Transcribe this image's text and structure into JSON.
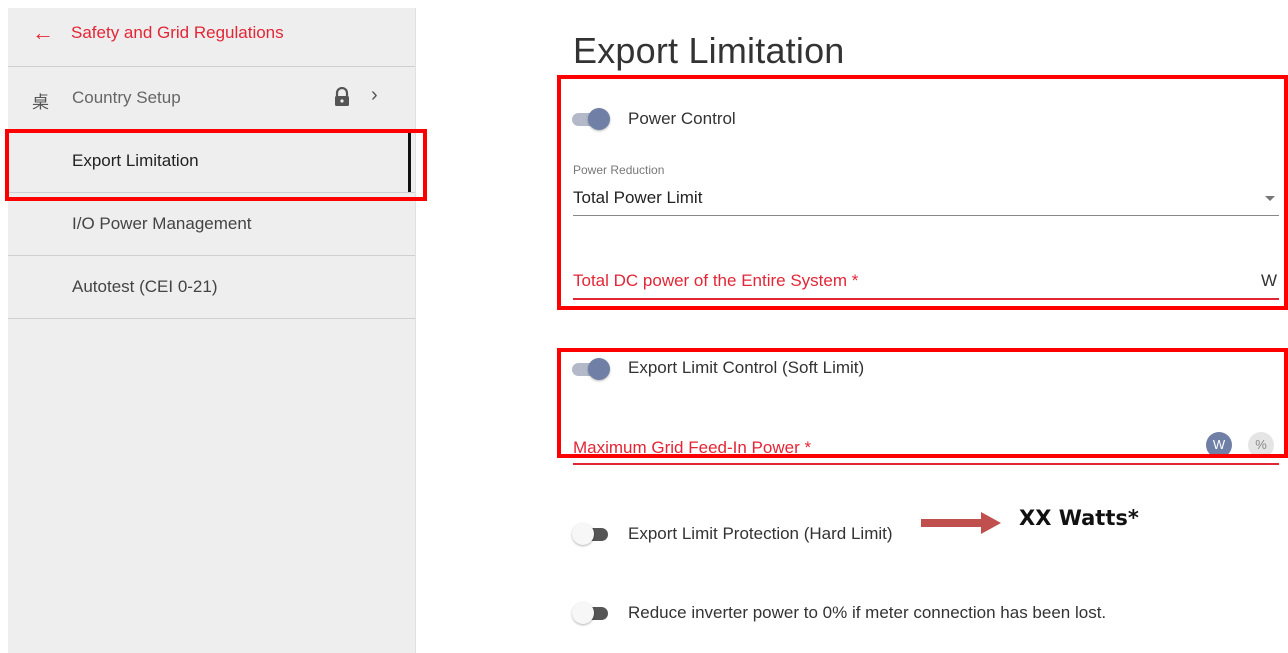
{
  "sidebar": {
    "back": {
      "label": "Safety and Grid Regulations",
      "icon": "arrow-left-icon"
    },
    "items": [
      {
        "label": "Country Setup",
        "icon": "transmission-tower-icon",
        "locked": true
      },
      {
        "label": "Export Limitation",
        "active": true
      },
      {
        "label": "I/O Power Management"
      },
      {
        "label": "Autotest (CEI 0-21)"
      }
    ]
  },
  "main": {
    "title": "Export Limitation",
    "power_control": {
      "label": "Power Control",
      "on": true,
      "reduction_label": "Power Reduction",
      "reduction_value": "Total Power Limit",
      "dc_power_label": "Total DC power of the Entire System *",
      "dc_power_unit": "W"
    },
    "export_limit": {
      "label": "Export Limit Control (Soft Limit)",
      "on": true,
      "feed_in_label": "Maximum Grid Feed-In Power *",
      "annotation": "XX Watts*",
      "unit_w": "W",
      "unit_pct": "%"
    },
    "protection": {
      "label": "Export Limit Protection (Hard Limit)",
      "on": false
    },
    "meter_lost": {
      "label": "Reduce inverter power to 0% if meter connection has been lost.",
      "on": false
    }
  },
  "colors": {
    "accent": "#e32636",
    "toggle_on": "#6f7fa6",
    "highlight": "#ff0000",
    "annotation_arrow": "#c0504d"
  }
}
